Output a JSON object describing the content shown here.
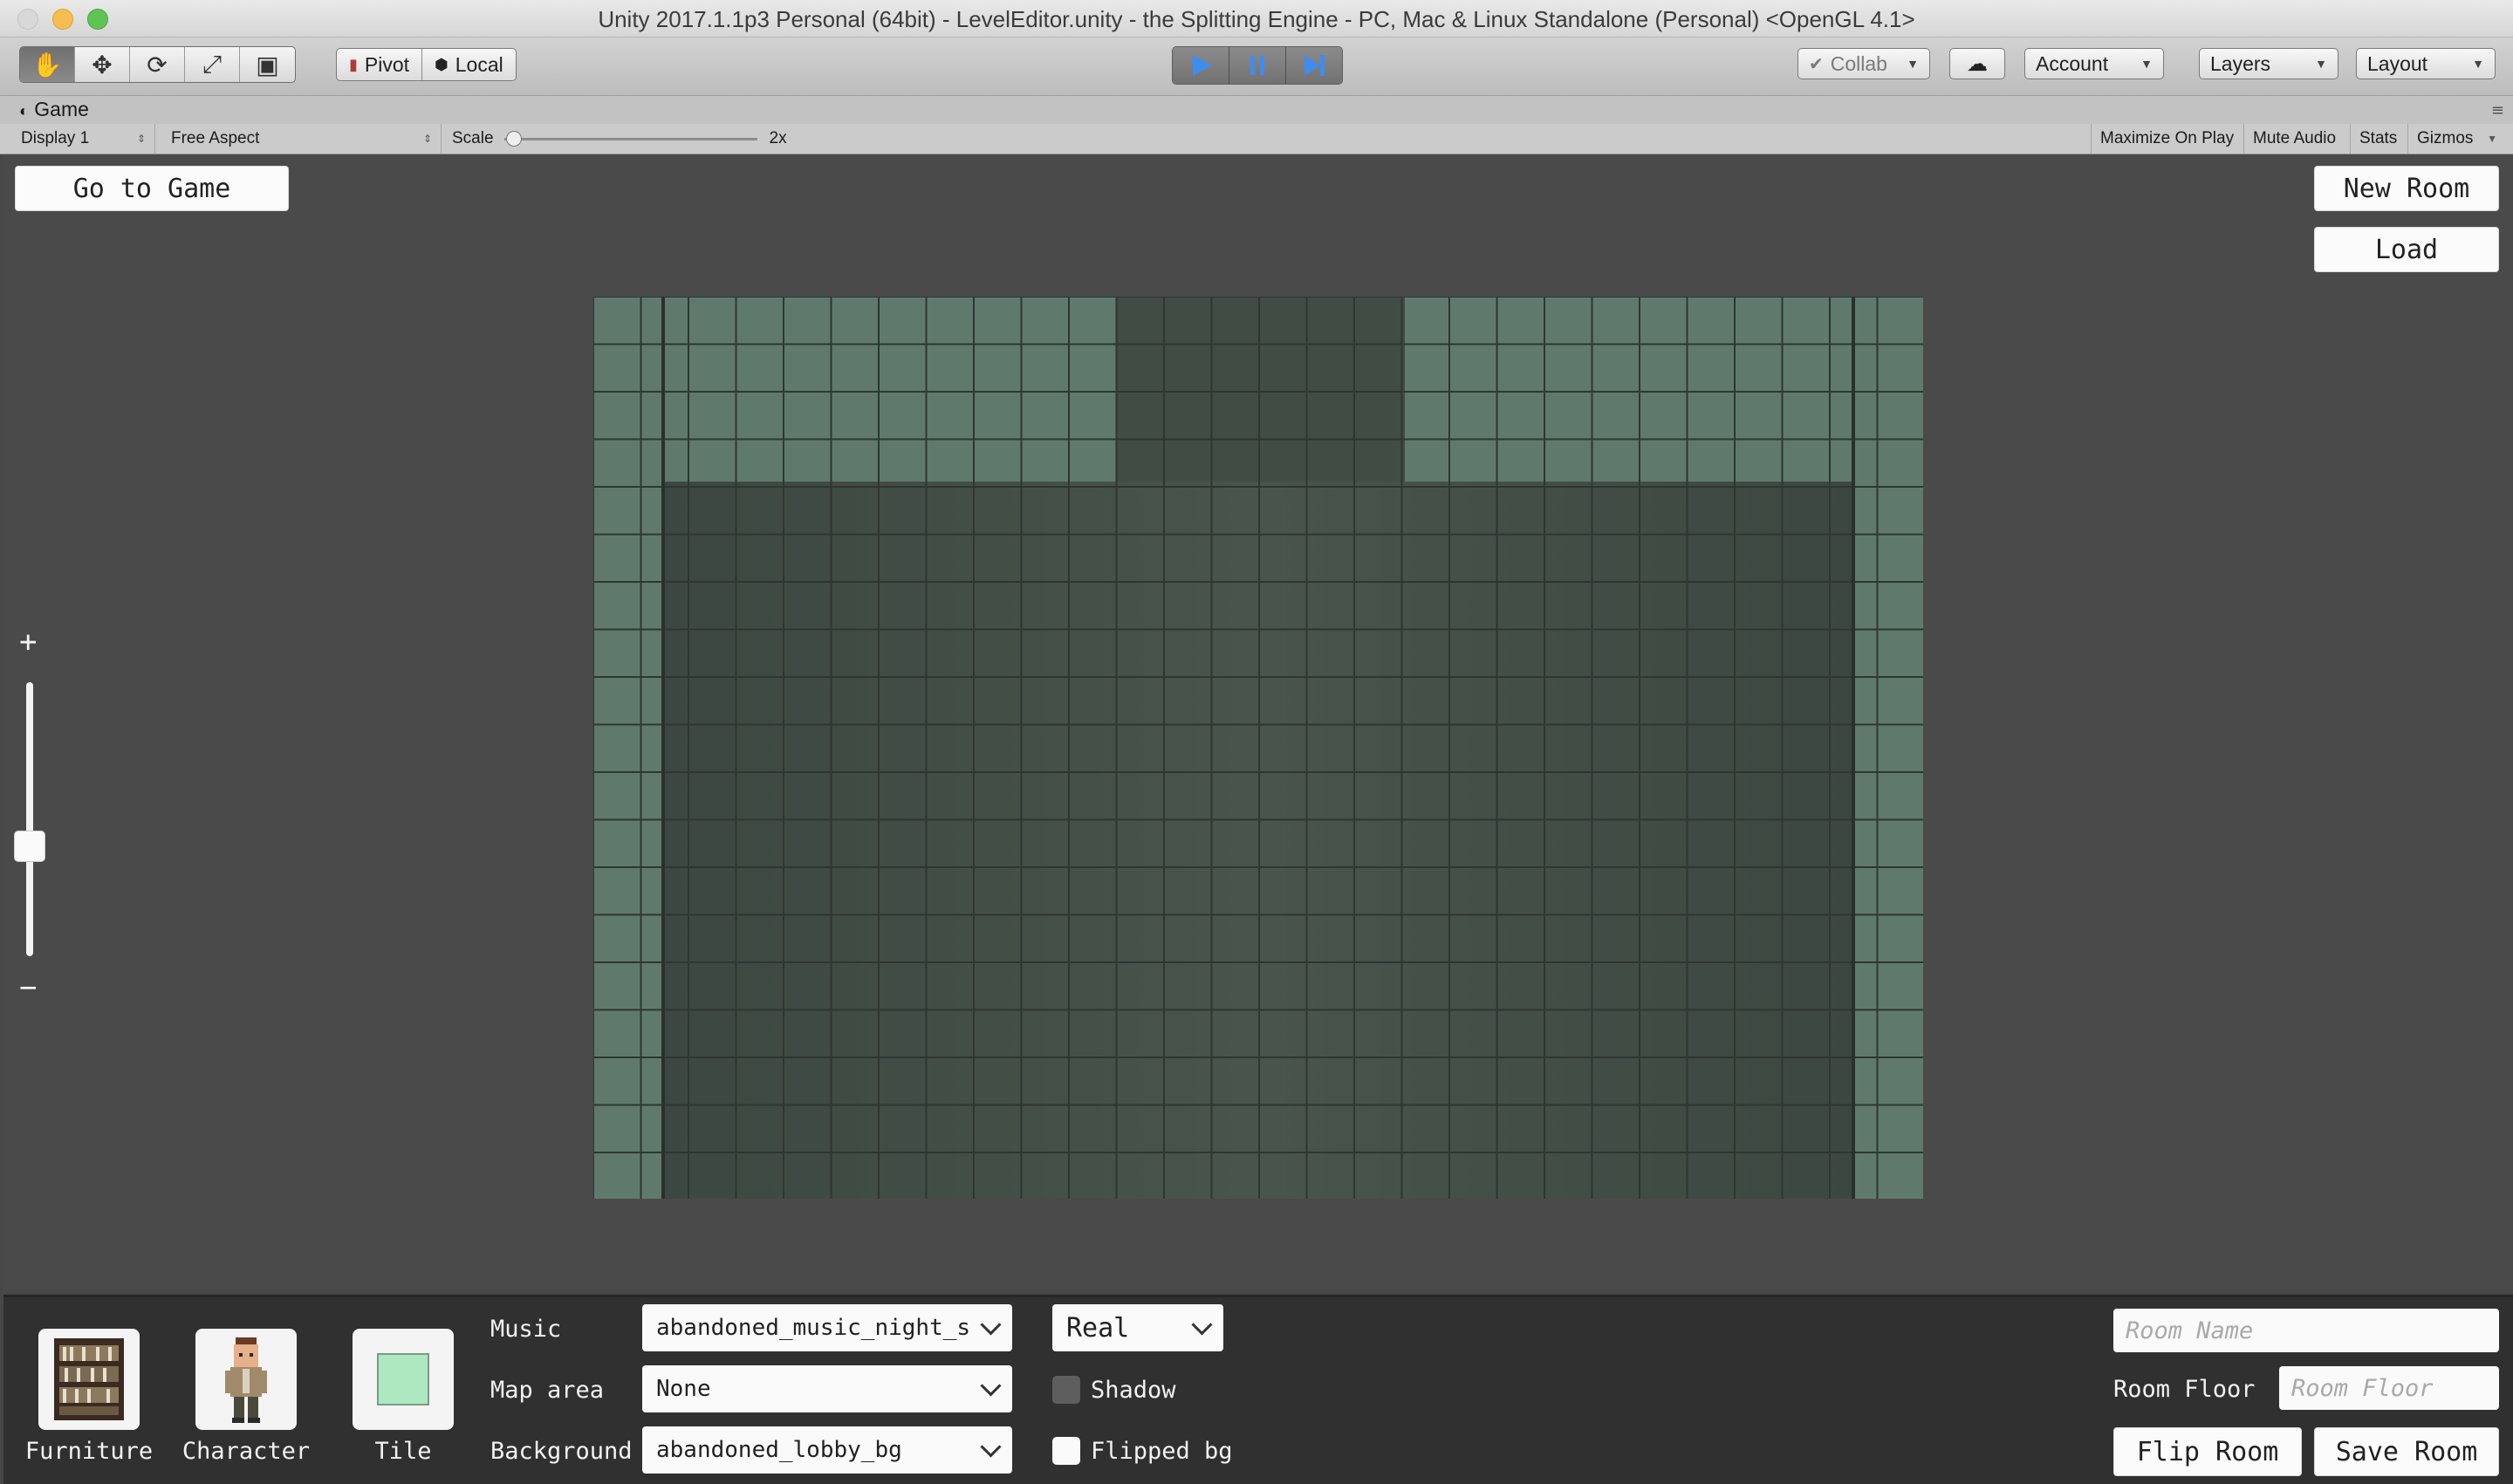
{
  "window": {
    "title": "Unity 2017.1.1p3 Personal (64bit) - LevelEditor.unity - the Splitting Engine - PC, Mac & Linux Standalone (Personal) <OpenGL 4.1>"
  },
  "toolbar": {
    "tools": [
      "hand-icon",
      "move-icon",
      "rotate-icon",
      "scale-icon",
      "rect-icon"
    ],
    "pivot_label": "Pivot",
    "local_label": "Local",
    "collab_label": "Collab",
    "account_label": "Account",
    "layers_label": "Layers",
    "layout_label": "Layout"
  },
  "game_tab": {
    "label": "Game",
    "display": "Display 1",
    "aspect": "Free Aspect",
    "scale_label": "Scale",
    "scale_value": "2x",
    "maximize_on_play": "Maximize On Play",
    "mute_audio": "Mute Audio",
    "stats": "Stats",
    "gizmos": "Gizmos"
  },
  "game": {
    "go_to_game": "Go to Game",
    "new_room": "New Room",
    "load": "Load",
    "zoom_plus": "+",
    "zoom_minus": "−",
    "zoom_level": 0.4
  },
  "editor_panel": {
    "palette": [
      {
        "label": "Furniture",
        "icon": "bookshelf-icon"
      },
      {
        "label": "Character",
        "icon": "character-icon"
      },
      {
        "label": "Tile",
        "icon": "tile-icon"
      }
    ],
    "music_label": "Music",
    "music_value": "abandoned_music_night_s",
    "map_area_label": "Map area",
    "map_area_value": "None",
    "background_label": "Background",
    "background_value": "abandoned_lobby_bg",
    "time_mode_value": "Real",
    "shadow_label": "Shadow",
    "flipped_bg_label": "Flipped bg",
    "room_name_placeholder": "Room Name",
    "room_floor_label": "Room Floor",
    "room_floor_placeholder": "Room Floor",
    "flip_room": "Flip Room",
    "save_room": "Save Room"
  },
  "colors": {
    "floor_light": "#5f7a6c",
    "floor_dark": "#414c45",
    "grid_line": "#2f3632",
    "play_accent": "#3f8cf0"
  }
}
